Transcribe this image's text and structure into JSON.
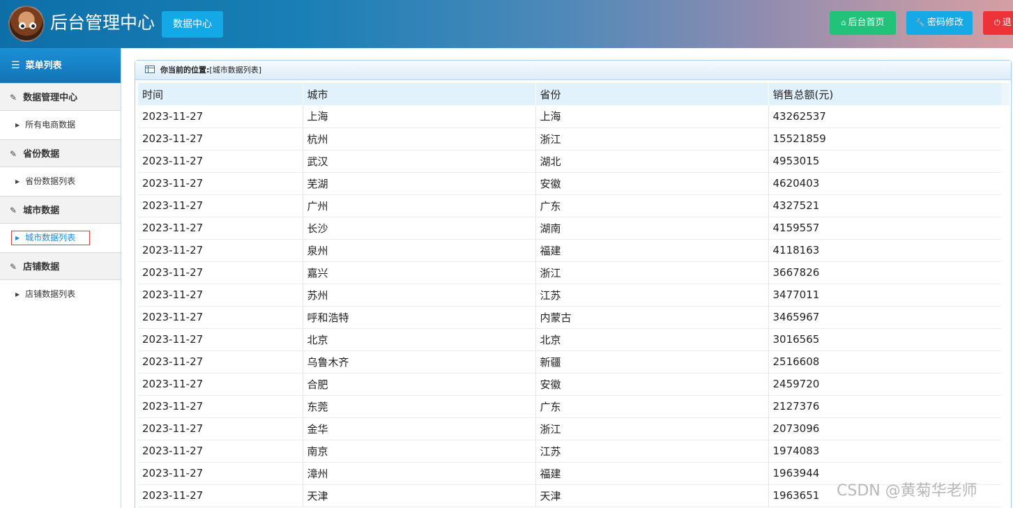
{
  "header": {
    "title": "后台管理中心",
    "data_center": "数据中心",
    "home_label": "后台首页",
    "pwd_label": "密码修改",
    "exit_label": "退"
  },
  "sidebar": {
    "title": "菜单列表",
    "groups": [
      {
        "label": "数据管理中心",
        "item": "所有电商数据"
      },
      {
        "label": "省份数据",
        "item": "省份数据列表"
      },
      {
        "label": "城市数据",
        "item": "城市数据列表"
      },
      {
        "label": "店铺数据",
        "item": "店铺数据列表"
      }
    ]
  },
  "breadcrumb": {
    "prefix": "你当前的位置:",
    "location": "[城市数据列表]"
  },
  "table": {
    "columns": [
      "时间",
      "城市",
      "省份",
      "销售总额(元)"
    ],
    "rows": [
      [
        "2023-11-27",
        "上海",
        "上海",
        "43262537"
      ],
      [
        "2023-11-27",
        "杭州",
        "浙江",
        "15521859"
      ],
      [
        "2023-11-27",
        "武汉",
        "湖北",
        "4953015"
      ],
      [
        "2023-11-27",
        "芜湖",
        "安徽",
        "4620403"
      ],
      [
        "2023-11-27",
        "广州",
        "广东",
        "4327521"
      ],
      [
        "2023-11-27",
        "长沙",
        "湖南",
        "4159557"
      ],
      [
        "2023-11-27",
        "泉州",
        "福建",
        "4118163"
      ],
      [
        "2023-11-27",
        "嘉兴",
        "浙江",
        "3667826"
      ],
      [
        "2023-11-27",
        "苏州",
        "江苏",
        "3477011"
      ],
      [
        "2023-11-27",
        "呼和浩特",
        "内蒙古",
        "3465967"
      ],
      [
        "2023-11-27",
        "北京",
        "北京",
        "3016565"
      ],
      [
        "2023-11-27",
        "乌鲁木齐",
        "新疆",
        "2516608"
      ],
      [
        "2023-11-27",
        "合肥",
        "安徽",
        "2459720"
      ],
      [
        "2023-11-27",
        "东莞",
        "广东",
        "2127376"
      ],
      [
        "2023-11-27",
        "金华",
        "浙江",
        "2073096"
      ],
      [
        "2023-11-27",
        "南京",
        "江苏",
        "1974083"
      ],
      [
        "2023-11-27",
        "漳州",
        "福建",
        "1963944"
      ],
      [
        "2023-11-27",
        "天津",
        "天津",
        "1963651"
      ]
    ]
  },
  "watermark": "CSDN @黄菊华老师",
  "colors": {
    "home_button": "#23c27a",
    "pwd_button": "#15aae6",
    "exit_button": "#ee3338",
    "menu_header": "#1c8fd6",
    "table_header": "#e2f2fc",
    "active_item": "#1e88d6"
  }
}
